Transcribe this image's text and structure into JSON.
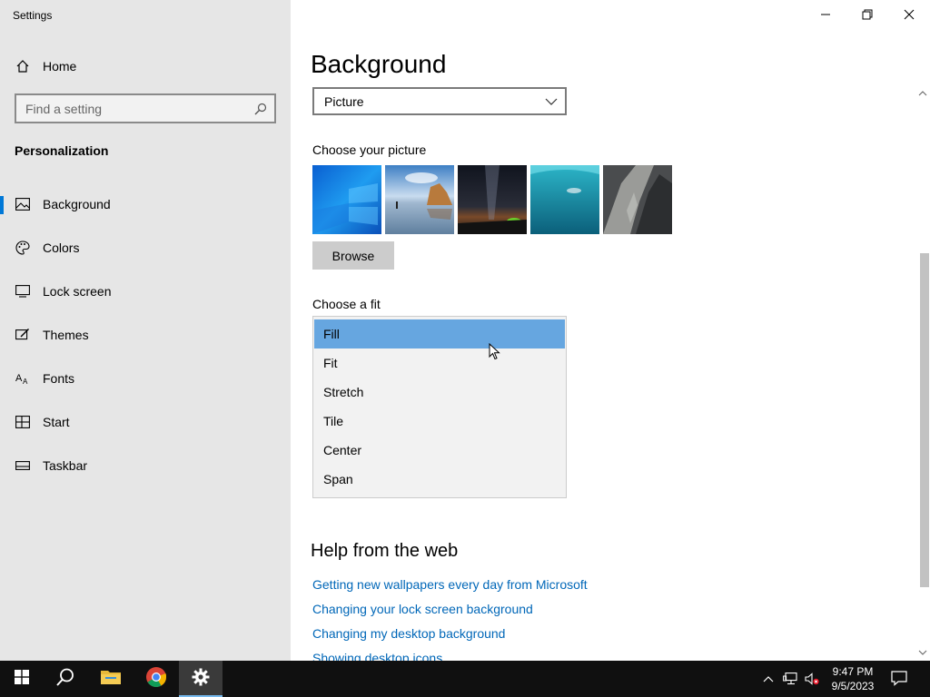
{
  "window": {
    "title": "Settings"
  },
  "sidebar": {
    "home_label": "Home",
    "search_placeholder": "Find a setting",
    "section_title": "Personalization",
    "items": [
      {
        "label": "Background",
        "icon": "image-icon",
        "active": true
      },
      {
        "label": "Colors",
        "icon": "palette-icon",
        "active": false
      },
      {
        "label": "Lock screen",
        "icon": "lock-screen-icon",
        "active": false
      },
      {
        "label": "Themes",
        "icon": "themes-icon",
        "active": false
      },
      {
        "label": "Fonts",
        "icon": "fonts-icon",
        "active": false
      },
      {
        "label": "Start",
        "icon": "start-icon",
        "active": false
      },
      {
        "label": "Taskbar",
        "icon": "taskbar-icon",
        "active": false
      }
    ]
  },
  "main": {
    "title": "Background",
    "background_type": "Picture",
    "choose_picture_label": "Choose your picture",
    "browse_label": "Browse",
    "choose_fit_label": "Choose a fit",
    "fit_options": [
      "Fill",
      "Fit",
      "Stretch",
      "Tile",
      "Center",
      "Span"
    ],
    "fit_selected": "Fill",
    "help_title": "Help from the web",
    "help_links": [
      "Getting new wallpapers every day from Microsoft",
      "Changing your lock screen background",
      "Changing my desktop background",
      "Showing desktop icons"
    ]
  },
  "taskbar": {
    "time": "9:47 PM",
    "date": "9/5/2023"
  },
  "colors": {
    "accent": "#0078d7",
    "selection": "#66a6e0",
    "link": "#0067b8",
    "sidebar_bg": "#e6e6e6",
    "taskbar_bg": "#101010"
  }
}
